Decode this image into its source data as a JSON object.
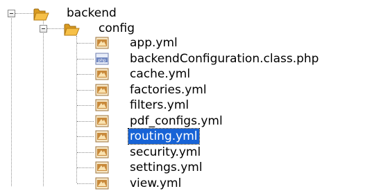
{
  "tree": {
    "root": {
      "label": "backend",
      "expanded": true,
      "icon": "folder-icon"
    },
    "child": {
      "label": "config",
      "expanded": true,
      "icon": "folder-icon"
    },
    "files": [
      {
        "label": "app.yml",
        "icon": "yml-file-icon",
        "selected": false
      },
      {
        "label": "backendConfiguration.class.php",
        "icon": "php-file-icon",
        "selected": false
      },
      {
        "label": "cache.yml",
        "icon": "yml-file-icon",
        "selected": false
      },
      {
        "label": "factories.yml",
        "icon": "yml-file-icon",
        "selected": false
      },
      {
        "label": "filters.yml",
        "icon": "yml-file-icon",
        "selected": false
      },
      {
        "label": "pdf_configs.yml",
        "icon": "yml-file-icon",
        "selected": false
      },
      {
        "label": "routing.yml",
        "icon": "yml-file-icon",
        "selected": true
      },
      {
        "label": "security.yml",
        "icon": "yml-file-icon",
        "selected": false
      },
      {
        "label": "settings.yml",
        "icon": "yml-file-icon",
        "selected": false
      },
      {
        "label": "view.yml",
        "icon": "yml-file-icon",
        "selected": false
      }
    ],
    "php_badge_text": "php",
    "colors": {
      "selection": "#1763d6",
      "folder": "#f2b133",
      "yml_icon": "#c8893a",
      "php_icon": "#6f86c0"
    }
  }
}
